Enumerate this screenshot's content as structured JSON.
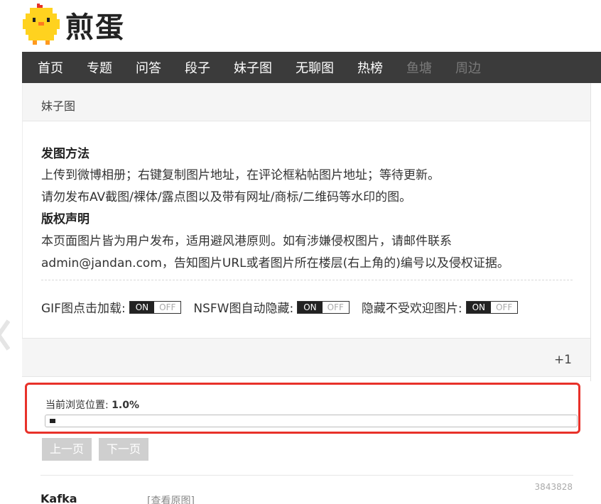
{
  "header": {
    "logo_text": "煎蛋",
    "logo_icon": "chick-icon"
  },
  "nav": {
    "items": [
      "首页",
      "专题",
      "问答",
      "段子",
      "妹子图",
      "无聊图",
      "热榜",
      "鱼塘",
      "周边"
    ]
  },
  "breadcrumb": {
    "label": "妹子图"
  },
  "rules": {
    "post_title": "发图方法",
    "post_line1": "上传到微博相册；右键复制图片地址，在评论框粘帖图片地址；等待更新。",
    "post_line2": "请勿发布AV截图/裸体/露点图以及带有网址/商标/二维码等水印的图。",
    "copyright_title": "版权声明",
    "copyright_line1": "本页面图片皆为用户发布，适用避风港原则。如有涉嫌侵权图片，请邮件联系",
    "copyright_line2": "admin@jandan.com，告知图片URL或者图片所在楼层(右上角的)编号以及侵权证据。"
  },
  "options": {
    "gif_label": "GIF图点击加载:",
    "nsfw_label": "NSFW图自动隐藏:",
    "unpopular_label": "隐藏不受欢迎图片:",
    "on": "ON",
    "off": "OFF"
  },
  "strip": {
    "plus": "+1"
  },
  "progress": {
    "label": "当前浏览位置: ",
    "value_text": "1.0%",
    "value": 0.01
  },
  "pager": {
    "prev": "上一页",
    "next": "下一页"
  },
  "post": {
    "id": "3843828",
    "author": "Kafka",
    "view_original": "[查看原图]"
  },
  "colors": {
    "nav_bg": "#3b3b3b",
    "highlight": "#e8312a",
    "accent_chick": "#ffd21f"
  }
}
